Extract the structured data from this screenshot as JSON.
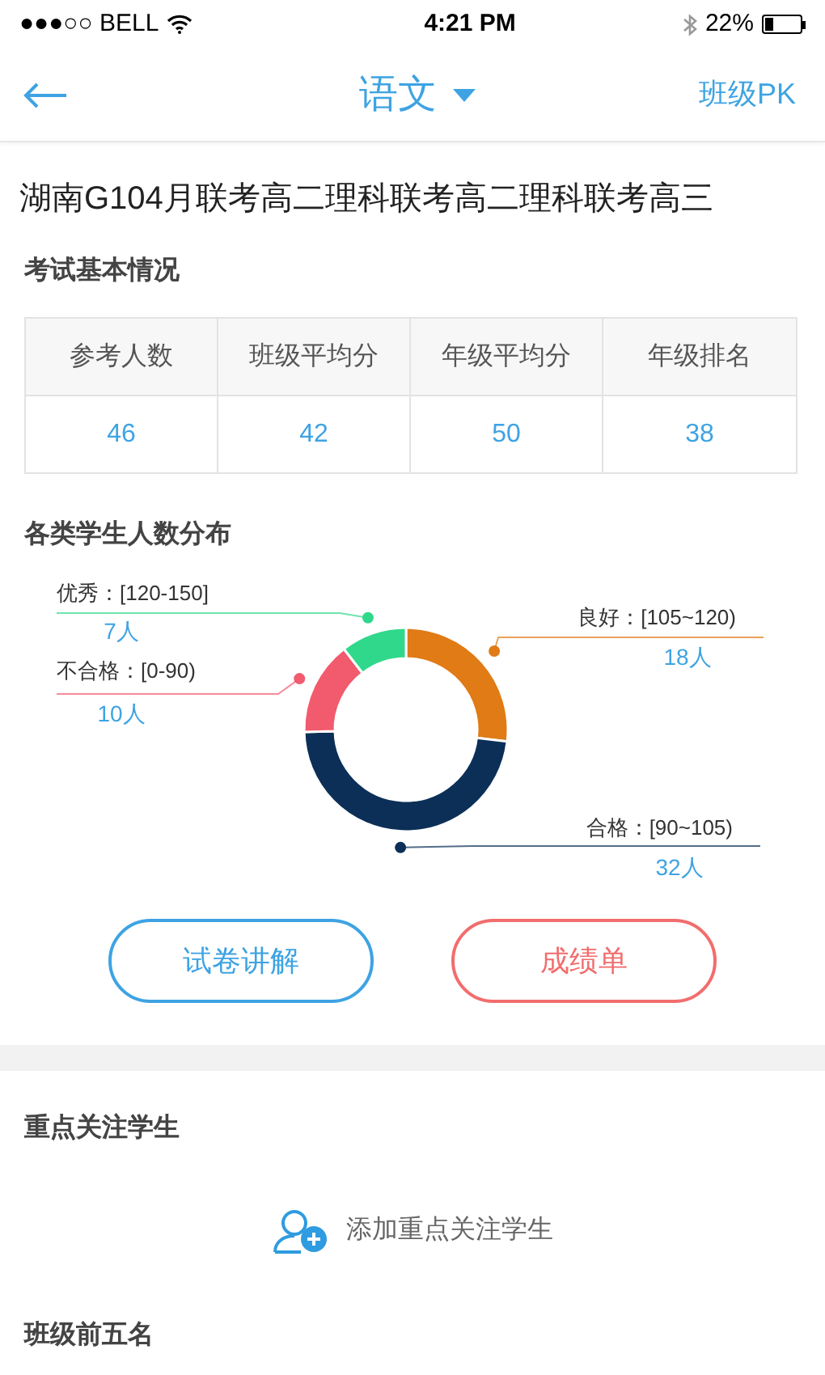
{
  "status_bar": {
    "carrier": "●●●○○ BELL",
    "time": "4:21 PM",
    "battery": "22%"
  },
  "nav": {
    "title": "语文",
    "action": "班级PK"
  },
  "exam_title": "湖南G104月联考高二理科联考高二理科联考高三",
  "basic_info": {
    "title": "考试基本情况",
    "columns": [
      "参考人数",
      "班级平均分",
      "年级平均分",
      "年级排名"
    ],
    "values": [
      "46",
      "42",
      "50",
      "38"
    ]
  },
  "distribution": {
    "title": "各类学生人数分布",
    "chart_data": {
      "type": "donut",
      "categories": [
        "良好：[105~120)",
        "合格：[90~105)",
        "不合格：[0-90)",
        "优秀：[120-150]"
      ],
      "values": [
        18,
        32,
        10,
        7
      ],
      "colors": [
        "#e07b16",
        "#0c2f57",
        "#f25a6e",
        "#2fd88a"
      ],
      "value_labels": [
        "18人",
        "32人",
        "10人",
        "7人"
      ]
    }
  },
  "buttons": [
    {
      "label": "试卷讲解",
      "kind": "primary"
    },
    {
      "label": "成绩单",
      "kind": "danger"
    }
  ],
  "focus_students": {
    "title": "重点关注学生",
    "add_label": "添加重点关注学生"
  },
  "top_five": {
    "title": "班级前五名"
  }
}
